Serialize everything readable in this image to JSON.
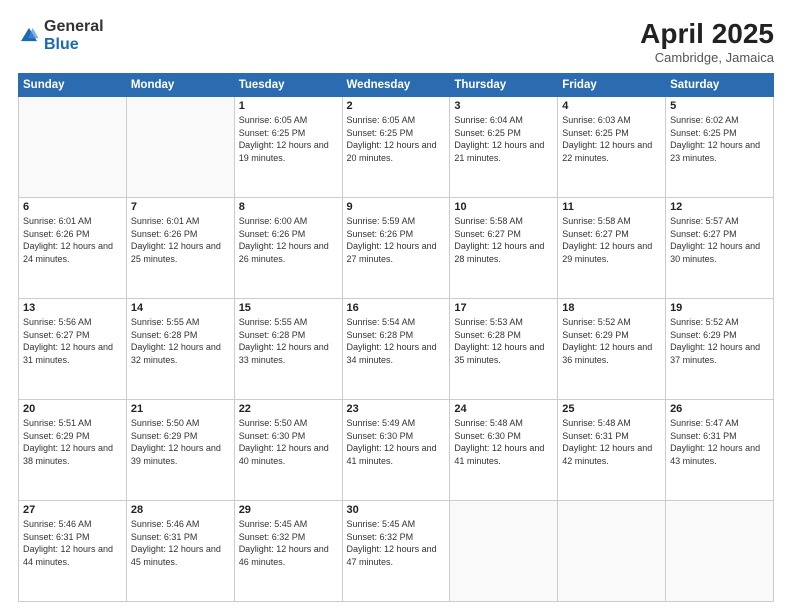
{
  "logo": {
    "general": "General",
    "blue": "Blue"
  },
  "title": "April 2025",
  "subtitle": "Cambridge, Jamaica",
  "days_header": [
    "Sunday",
    "Monday",
    "Tuesday",
    "Wednesday",
    "Thursday",
    "Friday",
    "Saturday"
  ],
  "weeks": [
    [
      {
        "day": "",
        "info": ""
      },
      {
        "day": "",
        "info": ""
      },
      {
        "day": "1",
        "info": "Sunrise: 6:05 AM\nSunset: 6:25 PM\nDaylight: 12 hours and 19 minutes."
      },
      {
        "day": "2",
        "info": "Sunrise: 6:05 AM\nSunset: 6:25 PM\nDaylight: 12 hours and 20 minutes."
      },
      {
        "day": "3",
        "info": "Sunrise: 6:04 AM\nSunset: 6:25 PM\nDaylight: 12 hours and 21 minutes."
      },
      {
        "day": "4",
        "info": "Sunrise: 6:03 AM\nSunset: 6:25 PM\nDaylight: 12 hours and 22 minutes."
      },
      {
        "day": "5",
        "info": "Sunrise: 6:02 AM\nSunset: 6:25 PM\nDaylight: 12 hours and 23 minutes."
      }
    ],
    [
      {
        "day": "6",
        "info": "Sunrise: 6:01 AM\nSunset: 6:26 PM\nDaylight: 12 hours and 24 minutes."
      },
      {
        "day": "7",
        "info": "Sunrise: 6:01 AM\nSunset: 6:26 PM\nDaylight: 12 hours and 25 minutes."
      },
      {
        "day": "8",
        "info": "Sunrise: 6:00 AM\nSunset: 6:26 PM\nDaylight: 12 hours and 26 minutes."
      },
      {
        "day": "9",
        "info": "Sunrise: 5:59 AM\nSunset: 6:26 PM\nDaylight: 12 hours and 27 minutes."
      },
      {
        "day": "10",
        "info": "Sunrise: 5:58 AM\nSunset: 6:27 PM\nDaylight: 12 hours and 28 minutes."
      },
      {
        "day": "11",
        "info": "Sunrise: 5:58 AM\nSunset: 6:27 PM\nDaylight: 12 hours and 29 minutes."
      },
      {
        "day": "12",
        "info": "Sunrise: 5:57 AM\nSunset: 6:27 PM\nDaylight: 12 hours and 30 minutes."
      }
    ],
    [
      {
        "day": "13",
        "info": "Sunrise: 5:56 AM\nSunset: 6:27 PM\nDaylight: 12 hours and 31 minutes."
      },
      {
        "day": "14",
        "info": "Sunrise: 5:55 AM\nSunset: 6:28 PM\nDaylight: 12 hours and 32 minutes."
      },
      {
        "day": "15",
        "info": "Sunrise: 5:55 AM\nSunset: 6:28 PM\nDaylight: 12 hours and 33 minutes."
      },
      {
        "day": "16",
        "info": "Sunrise: 5:54 AM\nSunset: 6:28 PM\nDaylight: 12 hours and 34 minutes."
      },
      {
        "day": "17",
        "info": "Sunrise: 5:53 AM\nSunset: 6:28 PM\nDaylight: 12 hours and 35 minutes."
      },
      {
        "day": "18",
        "info": "Sunrise: 5:52 AM\nSunset: 6:29 PM\nDaylight: 12 hours and 36 minutes."
      },
      {
        "day": "19",
        "info": "Sunrise: 5:52 AM\nSunset: 6:29 PM\nDaylight: 12 hours and 37 minutes."
      }
    ],
    [
      {
        "day": "20",
        "info": "Sunrise: 5:51 AM\nSunset: 6:29 PM\nDaylight: 12 hours and 38 minutes."
      },
      {
        "day": "21",
        "info": "Sunrise: 5:50 AM\nSunset: 6:29 PM\nDaylight: 12 hours and 39 minutes."
      },
      {
        "day": "22",
        "info": "Sunrise: 5:50 AM\nSunset: 6:30 PM\nDaylight: 12 hours and 40 minutes."
      },
      {
        "day": "23",
        "info": "Sunrise: 5:49 AM\nSunset: 6:30 PM\nDaylight: 12 hours and 41 minutes."
      },
      {
        "day": "24",
        "info": "Sunrise: 5:48 AM\nSunset: 6:30 PM\nDaylight: 12 hours and 41 minutes."
      },
      {
        "day": "25",
        "info": "Sunrise: 5:48 AM\nSunset: 6:31 PM\nDaylight: 12 hours and 42 minutes."
      },
      {
        "day": "26",
        "info": "Sunrise: 5:47 AM\nSunset: 6:31 PM\nDaylight: 12 hours and 43 minutes."
      }
    ],
    [
      {
        "day": "27",
        "info": "Sunrise: 5:46 AM\nSunset: 6:31 PM\nDaylight: 12 hours and 44 minutes."
      },
      {
        "day": "28",
        "info": "Sunrise: 5:46 AM\nSunset: 6:31 PM\nDaylight: 12 hours and 45 minutes."
      },
      {
        "day": "29",
        "info": "Sunrise: 5:45 AM\nSunset: 6:32 PM\nDaylight: 12 hours and 46 minutes."
      },
      {
        "day": "30",
        "info": "Sunrise: 5:45 AM\nSunset: 6:32 PM\nDaylight: 12 hours and 47 minutes."
      },
      {
        "day": "",
        "info": ""
      },
      {
        "day": "",
        "info": ""
      },
      {
        "day": "",
        "info": ""
      }
    ]
  ]
}
